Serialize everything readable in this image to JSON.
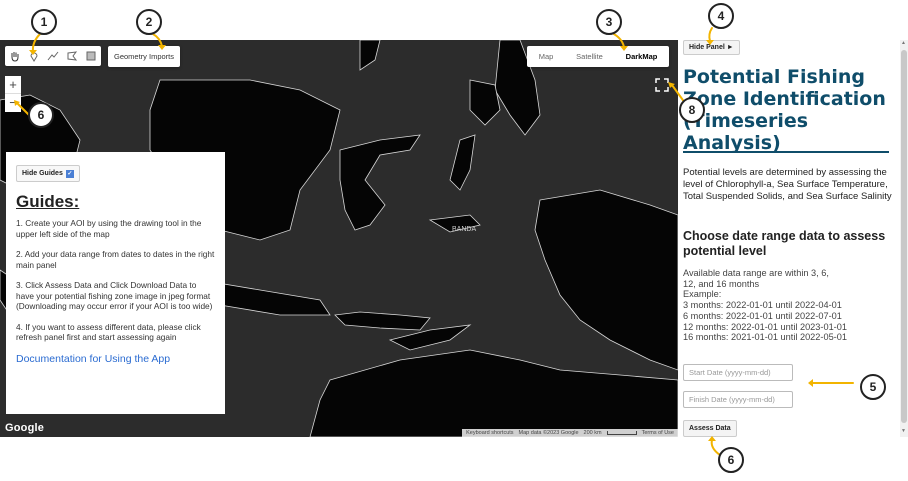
{
  "map": {
    "geometry_imports": "Geometry Imports",
    "map_types": [
      "Map",
      "Satellite",
      "DarkMap"
    ],
    "selected_map_type": "DarkMap",
    "zoom_in": "+",
    "zoom_out": "−",
    "google_logo": "Google",
    "attribution": {
      "shortcuts": "Keyboard shortcuts",
      "data": "Map data ©2023 Google",
      "scale": "200 km",
      "terms": "Terms of Use"
    },
    "map_label": "BANDA"
  },
  "guides": {
    "hide_label": "Hide Guides",
    "title": "Guides:",
    "steps": [
      "1. Create your AOI by using the drawing tool in the upper left side of the map",
      "2. Add your data range from dates to dates in the right main panel",
      "3. Click Assess Data and Click Download Data to have your potential fishing zone image in jpeg format (Downloading may occur error if your AOI is too wide)",
      "4. If you want to assess different data, please click refresh panel first and start assessing again"
    ],
    "link": "Documentation for Using the App"
  },
  "panel": {
    "hide_label": "Hide Panel ►",
    "title": "Potential Fishing Zone Identification (Timeseries Analysis)",
    "description": "Potential levels are determined by assessing the level of Chlorophyll-a, Sea Surface Temperature, Total Suspended Solids, and Sea Surface Salinity",
    "subtitle": "Choose date range data to assess potential level",
    "range_lines": [
      "Available data range are within 3, 6,",
      "12, and 16 months",
      "Example:",
      "3 months: 2022-01-01 until 2022-04-01",
      "6 months: 2022-01-01 until 2022-07-01",
      "12 months: 2022-01-01 until 2023-01-01",
      "16 months: 2021-01-01 until 2022-05-01"
    ],
    "start_placeholder": "Start Date (yyyy-mm-dd)",
    "finish_placeholder": "Finish Date (yyyy-mm-dd)",
    "assess_label": "Assess Data"
  },
  "callouts": [
    "1",
    "2",
    "3",
    "4",
    "5",
    "6",
    "6",
    "8"
  ],
  "colors": {
    "map_bg": "#2c2c2c",
    "land": "#050505",
    "title": "#0f4d6a",
    "link": "#2a6bd1",
    "arrow": "#f2b400"
  },
  "icons": [
    "hand-icon",
    "marker-icon",
    "polyline-icon",
    "polygon-icon",
    "rectangle-icon",
    "fullscreen-icon"
  ]
}
